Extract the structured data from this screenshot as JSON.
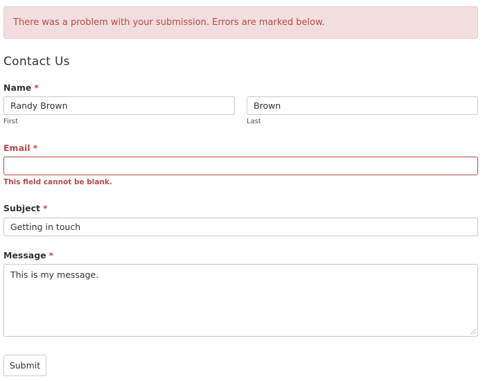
{
  "alert": {
    "message": "There was a problem with your submission. Errors are marked below."
  },
  "form": {
    "title": "Contact Us",
    "required_marker": "*",
    "name": {
      "label": "Name",
      "first_value": "Randy Brown",
      "first_sublabel": "First",
      "last_value": "Brown",
      "last_sublabel": "Last"
    },
    "email": {
      "label": "Email",
      "value": "",
      "error": "This field cannot be blank."
    },
    "subject": {
      "label": "Subject",
      "value": "Getting in touch"
    },
    "message": {
      "label": "Message",
      "value": "This is my message."
    },
    "submit_label": "Submit"
  },
  "colors": {
    "error": "#b94a48",
    "alert_background": "#f2dede",
    "border": "#cccccc"
  }
}
